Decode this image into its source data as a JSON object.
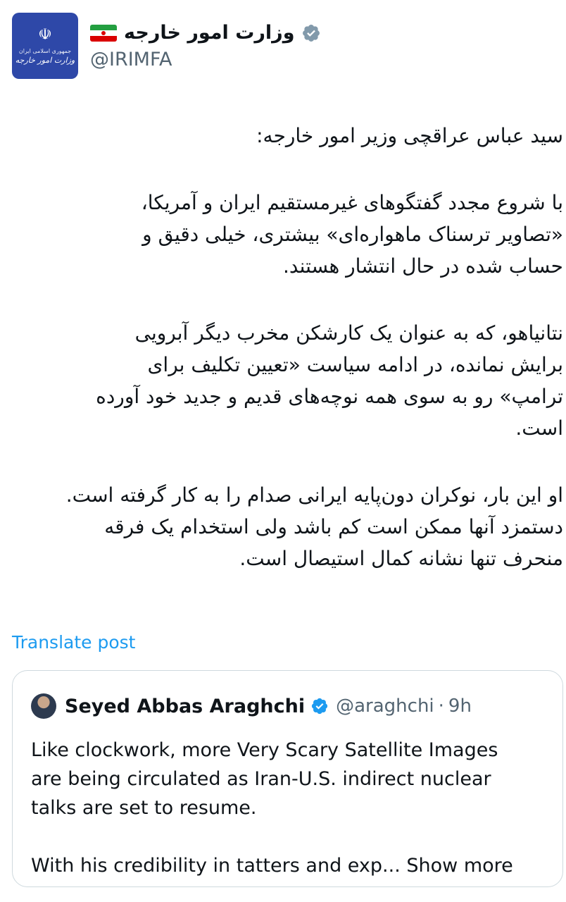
{
  "header": {
    "display_name": "وزارت امور خارجه",
    "handle": "@IRIMFA",
    "avatar_line1": "جمهوری اسلامی ایران",
    "avatar_line2": "وزارت امور خارجه",
    "flag_emoji": "🇮🇷"
  },
  "post": {
    "lines_block1": [
      "سید عباس عراقچی وزیر امور خارجه:"
    ],
    "lines_block2": [
      "با شروع مجدد گفتگوهای غیرمستقیم ایران و آمریکا،",
      "«تصاویر ترسناک ماهواره‌ای» بیشتری، خیلی دقیق و",
      "حساب شده در حال انتشار هستند."
    ],
    "lines_block3": [
      "نتانیاهو، که به عنوان یک کارشکن مخرب دیگر آبرویی",
      "برایش نمانده، در ادامه سیاست «تعیین تکلیف برای",
      "ترامپ» رو به سوی همه نوچه‌های قدیم و جدید خود آورده",
      "است."
    ],
    "lines_block4": [
      "او این بار، نوکران دون‌پایه ایرانی صدام را به کار گرفته است.",
      "دستمزد آنها ممکن است کم باشد ولی استخدام یک فرقه",
      "منحرف تنها نشانه کمال استیصال است."
    ],
    "translate_label": "Translate post"
  },
  "quote": {
    "name": "Seyed Abbas Araghchi",
    "handle": "@araghchi",
    "dot": "·",
    "time": "9h",
    "text_line1": "Like clockwork, more Very Scary Satellite Images",
    "text_line2": "are being circulated as Iran-U.S. indirect nuclear",
    "text_line3": "talks are set to resume.",
    "text_line4": "With his credibility in tatters and exp...",
    "show_more": "Show more"
  },
  "colors": {
    "link_blue": "#1d9bf0",
    "verified_blue": "#1d9bf0",
    "verified_gray": "#829aab",
    "secondary_text": "#536471",
    "border": "#cfd9de"
  }
}
